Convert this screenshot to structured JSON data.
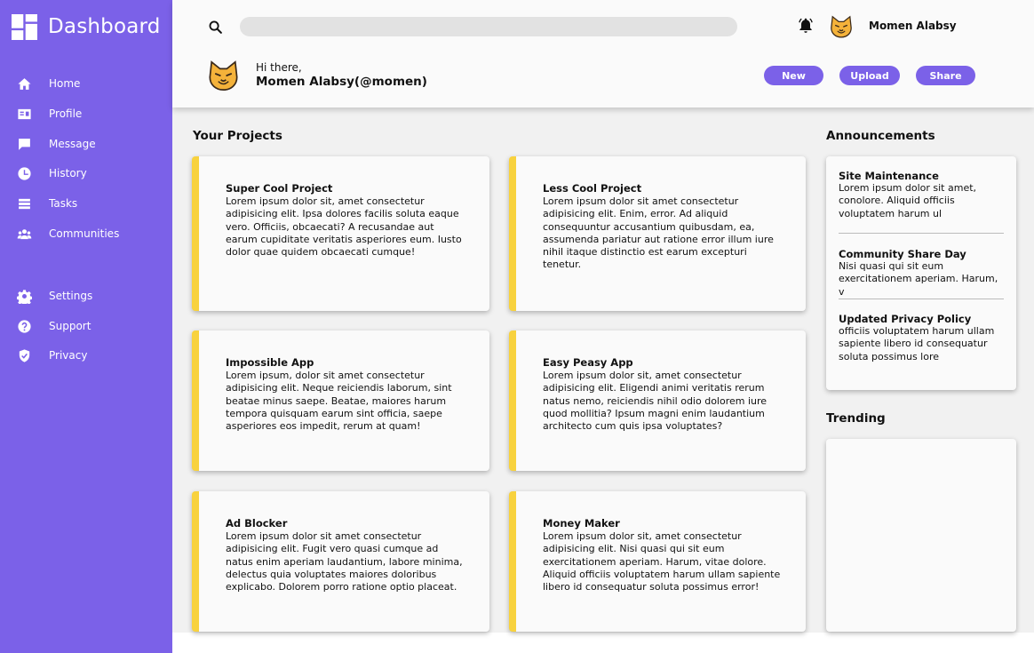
{
  "brand": {
    "title": "Dashboard",
    "icon": "dashboard-grid-icon"
  },
  "sidebar": {
    "items": [
      {
        "label": "Home",
        "icon": "home-icon"
      },
      {
        "label": "Profile",
        "icon": "id-card-icon"
      },
      {
        "label": "Message",
        "icon": "chat-bubble-icon"
      },
      {
        "label": "History",
        "icon": "clock-icon"
      },
      {
        "label": "Tasks",
        "icon": "list-icon"
      },
      {
        "label": "Communities",
        "icon": "users-icon"
      },
      {
        "label": "Settings",
        "icon": "gear-icon"
      },
      {
        "label": "Support",
        "icon": "help-circle-icon"
      },
      {
        "label": "Privacy",
        "icon": "shield-check-icon"
      }
    ]
  },
  "header": {
    "search_placeholder": "",
    "username": "Momen Alabsy",
    "greeting": "Hi there,",
    "display_name": "Momen Alabsy(@momen)",
    "buttons": {
      "new": "New",
      "upload": "Upload",
      "share": "Share"
    }
  },
  "projects": {
    "title": "Your Projects",
    "items": [
      {
        "title": "Super Cool Project",
        "body": "Lorem ipsum dolor sit, amet consectetur adipisicing elit. Ipsa dolores facilis soluta eaque vero. Officiis, obcaecati? A recusandae aut earum cupiditate veritatis asperiores eum. Iusto dolor quae quidem obcaecati cumque!"
      },
      {
        "title": "Less Cool Project",
        "body": "Lorem ipsum dolor sit amet consectetur adipisicing elit. Enim, error. Ad aliquid consequuntur accusantium quibusdam, ea, assumenda pariatur aut ratione error illum iure nihil itaque distinctio est earum excepturi tenetur."
      },
      {
        "title": "Impossible App",
        "body": "Lorem ipsum, dolor sit amet consectetur adipisicing elit. Neque reiciendis laborum, sint beatae minus saepe. Beatae, maiores harum tempora quisquam earum sint officia, saepe asperiores eos impedit, rerum at quam!"
      },
      {
        "title": "Easy Peasy App",
        "body": "Lorem ipsum dolor sit, amet consectetur adipisicing elit. Eligendi animi veritatis rerum natus nemo, reiciendis nihil odio dolorem iure quod mollitia? Ipsum magni enim laudantium architecto cum quis ipsa voluptates?"
      },
      {
        "title": "Ad Blocker",
        "body": "Lorem ipsum dolor sit amet consectetur adipisicing elit. Fugit vero quasi cumque ad natus enim aperiam laudantium, labore minima, delectus quia voluptates maiores doloribus explicabo. Dolorem porro ratione optio placeat."
      },
      {
        "title": "Money Maker",
        "body": "Lorem ipsum dolor sit, amet consectetur adipisicing elit. Nisi quasi qui sit eum exercitationem aperiam. Harum, vitae dolore. Aliquid officiis voluptatem harum ullam sapiente libero id consequatur soluta possimus error!"
      }
    ]
  },
  "announcements": {
    "title": "Announcements",
    "items": [
      {
        "title": "Site Maintenance",
        "body": "Lorem ipsum dolor sit amet, conolore. Aliquid officiis voluptatem harum ul"
      },
      {
        "title": "Community Share Day",
        "body": "Nisi quasi qui sit eum exercitationem aperiam. Harum, v"
      },
      {
        "title": "Updated Privacy Policy",
        "body": "officiis voluptatem harum ullam sapiente libero id consequatur soluta possimus lore"
      }
    ]
  },
  "trending": {
    "title": "Trending"
  },
  "colors": {
    "accent": "#7b61e8",
    "card_stripe": "#f8d23e",
    "background": "#f1f1f1",
    "surface": "#fafafa"
  }
}
